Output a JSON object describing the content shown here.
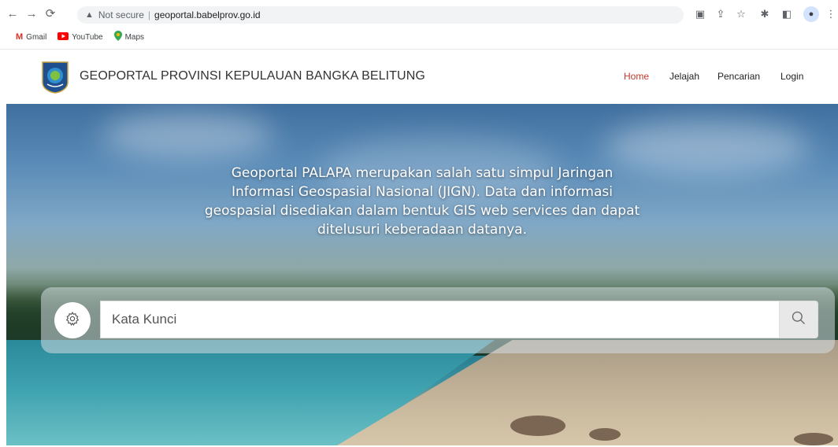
{
  "browser": {
    "security_label": "Not secure",
    "url": "geoportal.babelprov.go.id",
    "bookmarks": [
      {
        "label": "Gmail",
        "icon": "gmail-icon"
      },
      {
        "label": "YouTube",
        "icon": "youtube-icon"
      },
      {
        "label": "Maps",
        "icon": "maps-icon"
      }
    ]
  },
  "site": {
    "title": "GEOPORTAL PROVINSI KEPULAUAN BANGKA BELITUNG",
    "nav": [
      {
        "label": "Home",
        "active": true
      },
      {
        "label": "Jelajah",
        "active": false
      },
      {
        "label": "Pencarian",
        "active": false
      },
      {
        "label": "Login",
        "active": false
      }
    ]
  },
  "hero": {
    "lines": [
      "Geoportal PALAPA merupakan salah satu simpul Jaringan",
      "Informasi Geospasial Nasional (JIGN). Data dan informasi",
      "geospasial disediakan dalam bentuk GIS web services dan dapat",
      "ditelusuri keberadaan datanya."
    ]
  },
  "search": {
    "placeholder": "Kata Kunci"
  },
  "colors": {
    "nav_active": "#c0392b",
    "nav_default": "#222222"
  }
}
